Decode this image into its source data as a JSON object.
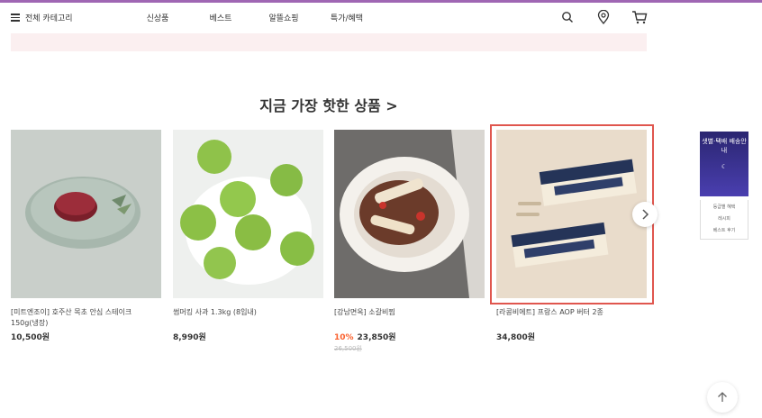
{
  "header": {
    "nav": {
      "category": "전체 카테고리",
      "items": [
        "신상품",
        "베스트",
        "알뜰쇼핑",
        "특가/혜택"
      ]
    },
    "icons": [
      "search-icon",
      "location-icon",
      "cart-icon"
    ]
  },
  "section": {
    "title": "지금 가장 핫한 상품 >"
  },
  "products": [
    {
      "name": "[미트엔조이] 호주산 목초 안심 스테이크 150g(냉장)",
      "price": "10,500원",
      "discount": "",
      "original_price": ""
    },
    {
      "name": "썸머킹 사과 1.3kg (8입내)",
      "price": "8,990원",
      "discount": "",
      "original_price": ""
    },
    {
      "name": "[강남면옥] 소갈비찜",
      "price": "23,850원",
      "discount": "10%",
      "original_price": "26,500원"
    },
    {
      "name": "[라콩비에트] 프랑스 AOP 버터 2종",
      "price": "34,800원",
      "discount": "",
      "original_price": ""
    }
  ],
  "sidebar": {
    "banner_text": "샛별·택배 배송안내",
    "links": [
      "등급별 혜택",
      "레시피",
      "베스트 후기"
    ]
  },
  "colors": {
    "brand": "#5f0080",
    "discount": "#fa622f",
    "highlight": "#e0564e"
  }
}
